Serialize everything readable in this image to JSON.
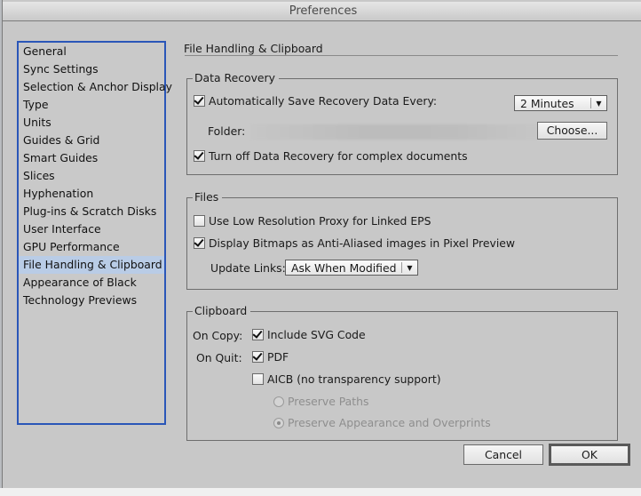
{
  "window": {
    "title": "Preferences"
  },
  "sidebar": {
    "items": [
      {
        "label": "General",
        "selected": false
      },
      {
        "label": "Sync Settings",
        "selected": false
      },
      {
        "label": "Selection & Anchor Display",
        "selected": false
      },
      {
        "label": "Type",
        "selected": false
      },
      {
        "label": "Units",
        "selected": false
      },
      {
        "label": "Guides & Grid",
        "selected": false
      },
      {
        "label": "Smart Guides",
        "selected": false
      },
      {
        "label": "Slices",
        "selected": false
      },
      {
        "label": "Hyphenation",
        "selected": false
      },
      {
        "label": "Plug-ins & Scratch Disks",
        "selected": false
      },
      {
        "label": "User Interface",
        "selected": false
      },
      {
        "label": "GPU Performance",
        "selected": false
      },
      {
        "label": "File Handling & Clipboard",
        "selected": true
      },
      {
        "label": "Appearance of Black",
        "selected": false
      },
      {
        "label": "Technology Previews",
        "selected": false
      }
    ]
  },
  "panel": {
    "title": "File Handling & Clipboard",
    "data_recovery": {
      "legend": "Data Recovery",
      "auto_save": {
        "label": "Automatically Save Recovery Data Every:",
        "checked": true
      },
      "interval": {
        "value": "2 Minutes"
      },
      "folder_label": "Folder:",
      "choose_label": "Choose...",
      "turn_off": {
        "label": "Turn off Data Recovery for complex documents",
        "checked": true
      }
    },
    "files": {
      "legend": "Files",
      "low_res_proxy": {
        "label": "Use Low Resolution Proxy for Linked EPS",
        "checked": false
      },
      "anti_aliased": {
        "label": "Display Bitmaps as Anti-Aliased images in Pixel Preview",
        "checked": true
      },
      "update_links_label": "Update Links:",
      "update_links_value": "Ask When Modified"
    },
    "clipboard": {
      "legend": "Clipboard",
      "on_copy_label": "On Copy:",
      "include_svg": {
        "label": "Include SVG Code",
        "checked": true
      },
      "on_quit_label": "On Quit:",
      "pdf": {
        "label": "PDF",
        "checked": true
      },
      "aicb": {
        "label": "AICB (no transparency support)",
        "checked": false
      },
      "preserve_paths": {
        "label": "Preserve Paths",
        "selected": false,
        "disabled": true
      },
      "preserve_appearance": {
        "label": "Preserve Appearance and Overprints",
        "selected": true,
        "disabled": true
      }
    }
  },
  "footer": {
    "cancel_label": "Cancel",
    "ok_label": "OK"
  }
}
